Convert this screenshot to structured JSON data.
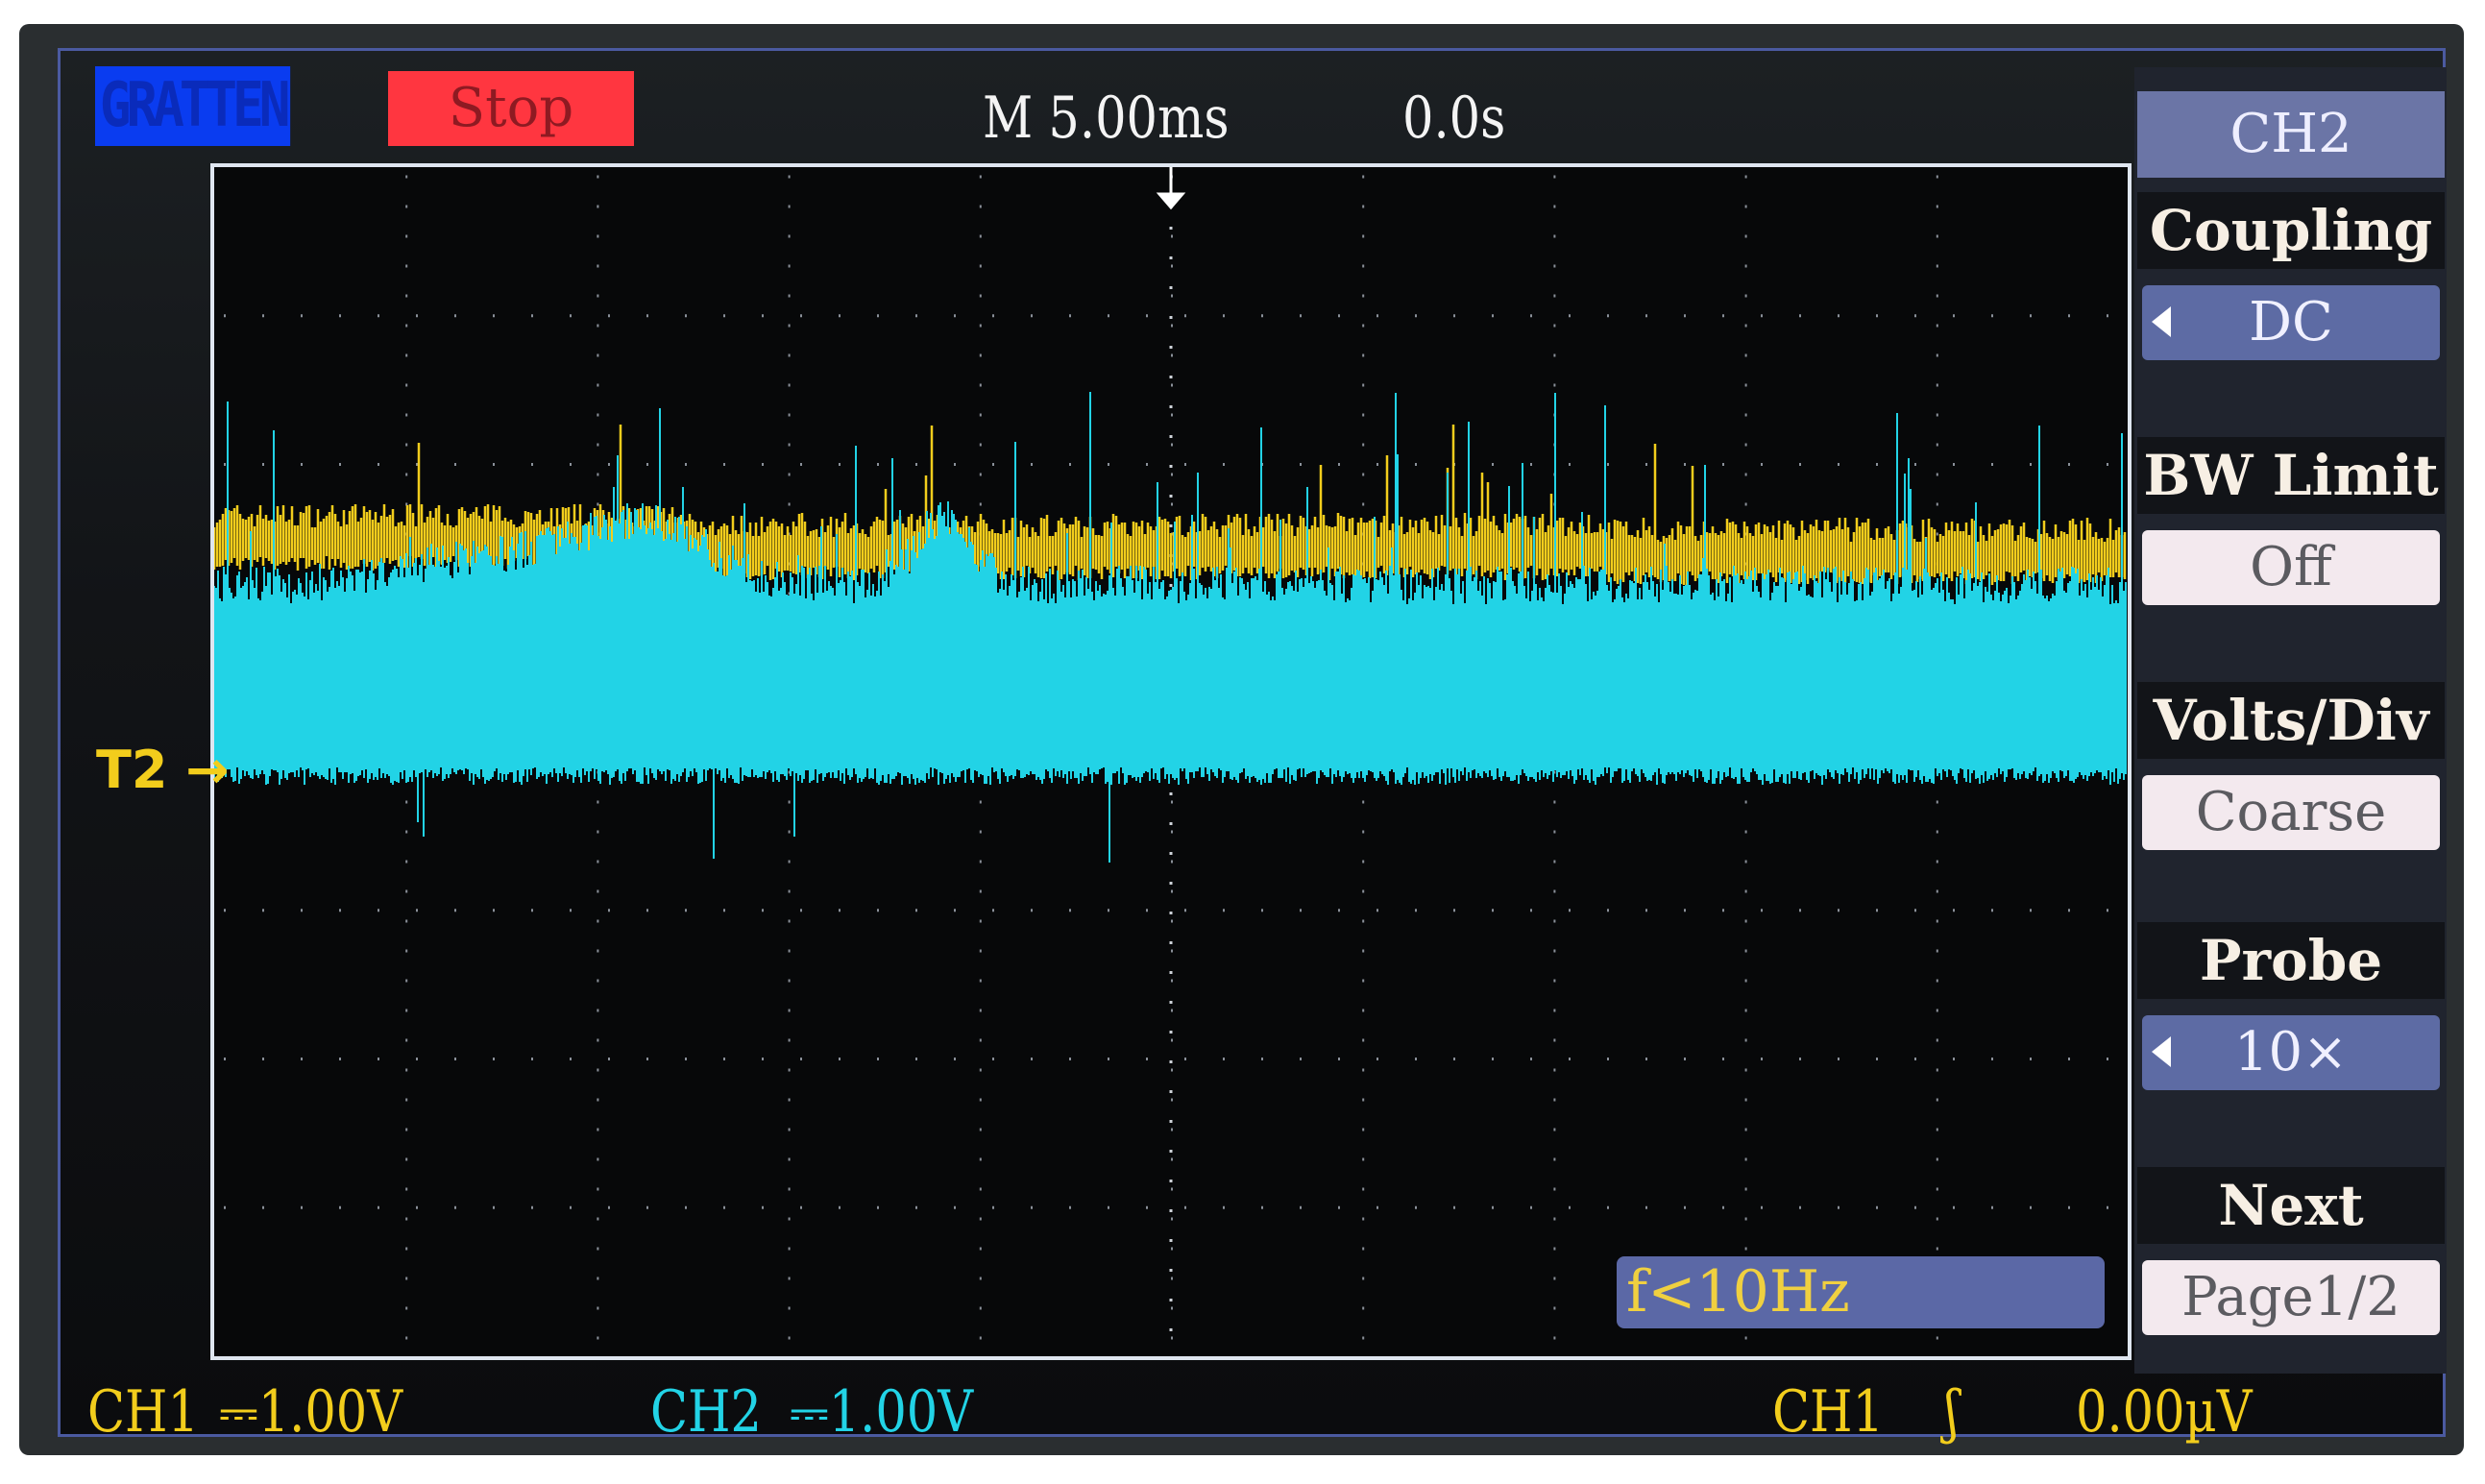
{
  "header": {
    "brand": "GRATTEN",
    "run_state": "Stop",
    "timebase": "M 5.00ms",
    "trigger_position": "0.0s"
  },
  "menu": {
    "title": "CH2",
    "items": [
      {
        "label": "Coupling",
        "value": "DC",
        "selector": true,
        "style": "blue"
      },
      {
        "label": "BW Limit",
        "value": "Off",
        "selector": false,
        "style": "light"
      },
      {
        "label": "Volts/Div",
        "value": "Coarse",
        "selector": false,
        "style": "light"
      },
      {
        "label": "Probe",
        "value": "10×",
        "selector": true,
        "style": "blue"
      },
      {
        "label": "Next Page",
        "value": "Page1/2",
        "selector": false,
        "style": "light"
      }
    ]
  },
  "freq_readout": "f<10Hz",
  "trigger_marker": "T2 →",
  "footer": {
    "ch1": "CH1",
    "ch1_scale": "⎓1.00V",
    "ch2": "CH2",
    "ch2_scale": "⎓1.00V",
    "trig_source": "CH1",
    "trig_edge": "ʃ",
    "trig_level": "0.00µV"
  },
  "colors": {
    "ch1": "#f2cd1c",
    "ch2": "#22d3e6",
    "stop": "#ff3640",
    "brand": "#0a3cf0"
  }
}
